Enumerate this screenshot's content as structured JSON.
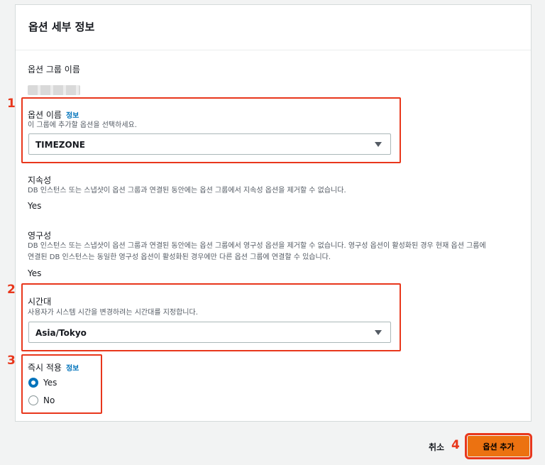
{
  "panel": {
    "title": "옵션 세부 정보"
  },
  "option_group": {
    "label": "옵션 그룹 이름"
  },
  "option_name": {
    "label": "옵션 이름",
    "info": "정보",
    "description": "이 그룹에 추가할 옵션을 선택하세요.",
    "selected": "TIMEZONE"
  },
  "persistence": {
    "label": "지속성",
    "description": "DB 인스턴스 또는 스냅샷이 옵션 그룹과 연결된 동안에는 옵션 그룹에서 지속성 옵션을 제거할 수 없습니다.",
    "value": "Yes"
  },
  "permanent": {
    "label": "영구성",
    "description_line1": "DB 인스턴스 또는 스냅샷이 옵션 그룹과 연결된 동안에는 옵션 그룹에서 영구성 옵션을 제거할 수 없습니다. 영구성 옵션이 활성화된 경우 현재 옵션 그룹에",
    "description_line2": "연결된 DB 인스턴스는 동일한 영구성 옵션이 활성화된 경우에만 다른 옵션 그룹에 연결할 수 있습니다.",
    "value": "Yes"
  },
  "timezone": {
    "label": "시간대",
    "description": "사용자가 시스템 시간을 변경하려는 시간대를 지정합니다.",
    "selected": "Asia/Tokyo"
  },
  "apply_immediately": {
    "label": "즉시 적용",
    "info": "정보",
    "options": [
      {
        "label": "Yes",
        "selected": true
      },
      {
        "label": "No",
        "selected": false
      }
    ]
  },
  "annotations": {
    "n1": "1",
    "n2": "2",
    "n3": "3",
    "n4": "4"
  },
  "footer": {
    "cancel": "취소",
    "submit": "옵션 추가"
  },
  "colors": {
    "accent": "#ec7211",
    "link": "#0073bb",
    "highlight": "#e8371c"
  }
}
